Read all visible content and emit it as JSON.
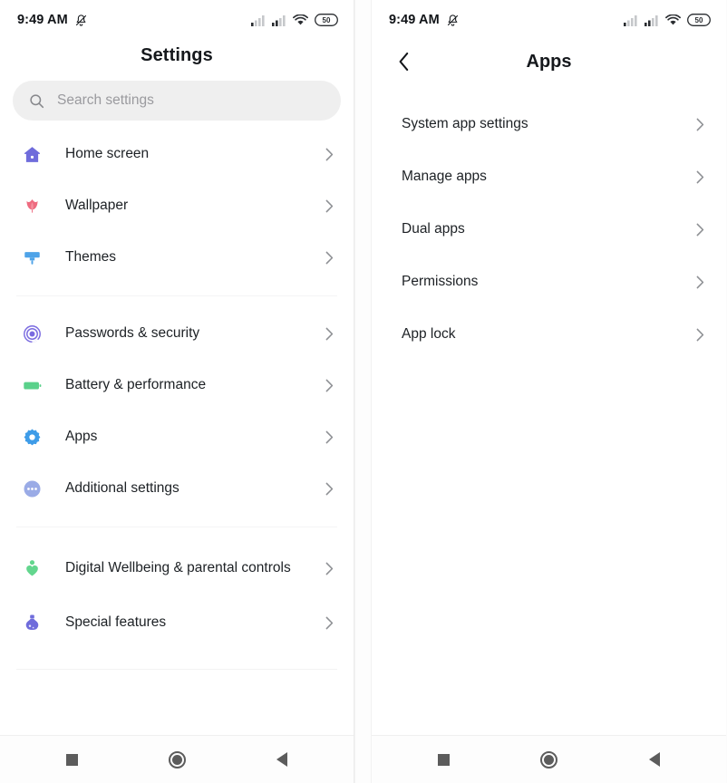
{
  "status_bar": {
    "time": "9:49 AM",
    "mute_icon": "bell-muted-icon",
    "signal1_icon": "signal-bars-icon",
    "signal2_icon": "signal-bars-icon",
    "wifi_icon": "wifi-icon",
    "battery_level": "50"
  },
  "left_panel": {
    "title": "Settings",
    "search": {
      "placeholder": "Search settings",
      "icon": "search-icon"
    },
    "groups": [
      {
        "items": [
          {
            "label": "Home screen",
            "icon": "home-icon",
            "color": "#6f6cdb"
          },
          {
            "label": "Wallpaper",
            "icon": "tulip-flower-icon",
            "color": "#ee6b80"
          },
          {
            "label": "Themes",
            "icon": "paintbrush-icon",
            "color": "#4ea3e8"
          }
        ]
      },
      {
        "items": [
          {
            "label": "Passwords & security",
            "icon": "fingerprint-icon",
            "color": "#7a6be0"
          },
          {
            "label": "Battery & performance",
            "icon": "battery-icon",
            "color": "#5ad18a"
          },
          {
            "label": "Apps",
            "icon": "gear-icon",
            "color": "#3e9ce8"
          },
          {
            "label": "Additional settings",
            "icon": "more-dots-circle-icon",
            "color": "#9aabe6"
          }
        ]
      },
      {
        "items": [
          {
            "label": "Digital Wellbeing & parental controls",
            "icon": "heart-person-icon",
            "color": "#63d68e"
          },
          {
            "label": "Special features",
            "icon": "flask-potion-icon",
            "color": "#6f6cdb"
          }
        ]
      }
    ],
    "chevron_icon": "chevron-right-icon"
  },
  "right_panel": {
    "title": "Apps",
    "back_icon": "chevron-left-icon",
    "items": [
      {
        "label": "System app settings"
      },
      {
        "label": "Manage apps"
      },
      {
        "label": "Dual apps"
      },
      {
        "label": "Permissions"
      },
      {
        "label": "App lock"
      }
    ],
    "chevron_icon": "chevron-right-icon"
  },
  "nav_bar": {
    "recents_icon": "square-recents-icon",
    "home_icon": "circle-home-icon",
    "back_icon": "triangle-back-icon"
  },
  "colors": {
    "accent_text": "#1d2125",
    "muted_text": "#9a9a9e",
    "search_bg": "#efefef",
    "nav_icon": "#5c5c5c"
  }
}
